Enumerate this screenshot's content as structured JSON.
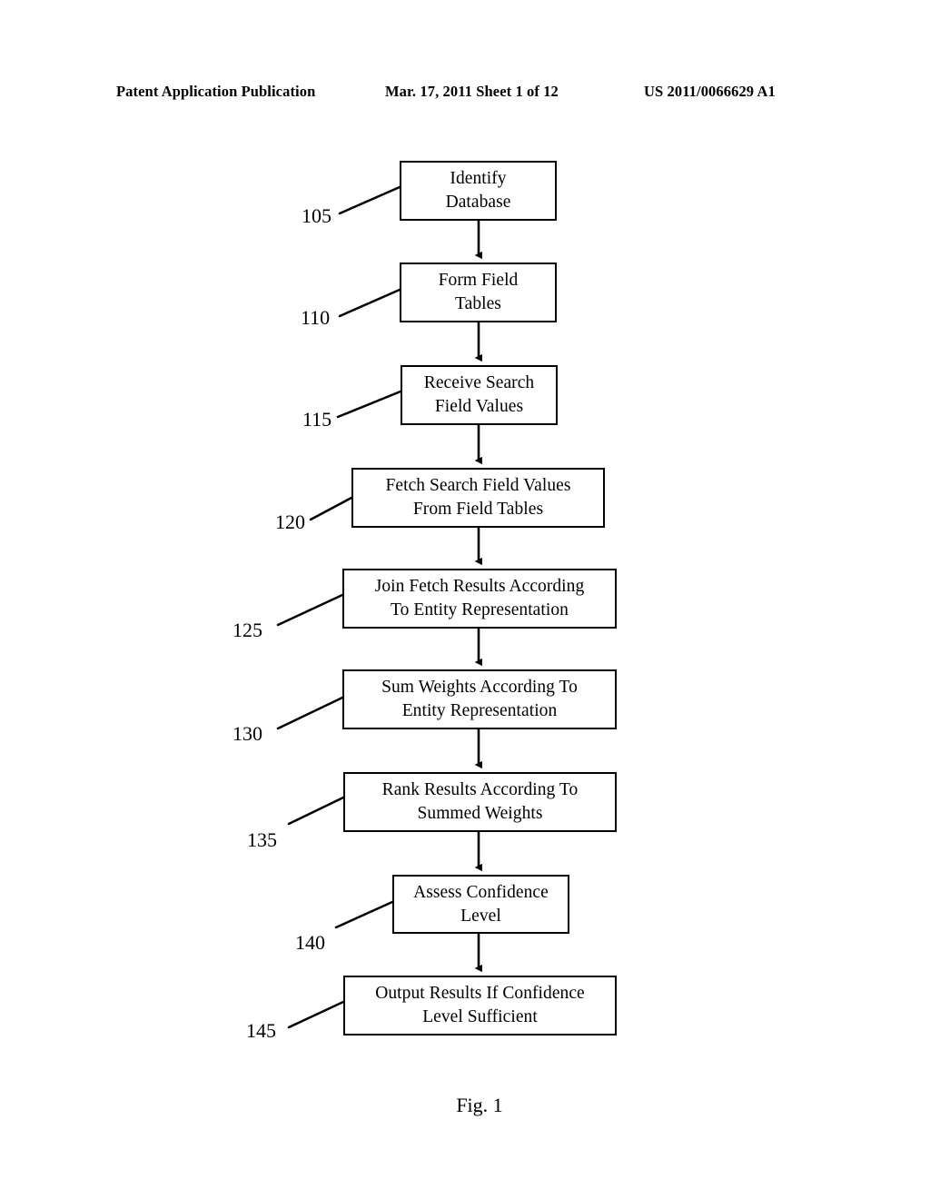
{
  "header": {
    "publication": "Patent Application Publication",
    "date_sheet": "Mar. 17, 2011  Sheet 1 of 12",
    "pub_number": "US 2011/0066629 A1"
  },
  "figure": {
    "caption": "Fig. 1",
    "type": "flowchart",
    "orientation": "top-to-bottom",
    "line_color": "#000000",
    "background_color": "#ffffff"
  },
  "flowchart": {
    "nodes": [
      {
        "ref": "105",
        "text": "Identify\nDatabase"
      },
      {
        "ref": "110",
        "text": "Form Field\nTables"
      },
      {
        "ref": "115",
        "text": "Receive Search\nField Values"
      },
      {
        "ref": "120",
        "text": "Fetch Search Field Values\nFrom Field Tables"
      },
      {
        "ref": "125",
        "text": "Join Fetch Results According\nTo Entity Representation"
      },
      {
        "ref": "130",
        "text": "Sum Weights According To\nEntity Representation"
      },
      {
        "ref": "135",
        "text": "Rank Results According To\nSummed Weights"
      },
      {
        "ref": "140",
        "text": "Assess Confidence\nLevel"
      },
      {
        "ref": "145",
        "text": "Output Results If Confidence\nLevel Sufficient"
      }
    ],
    "connector_count": 8
  }
}
